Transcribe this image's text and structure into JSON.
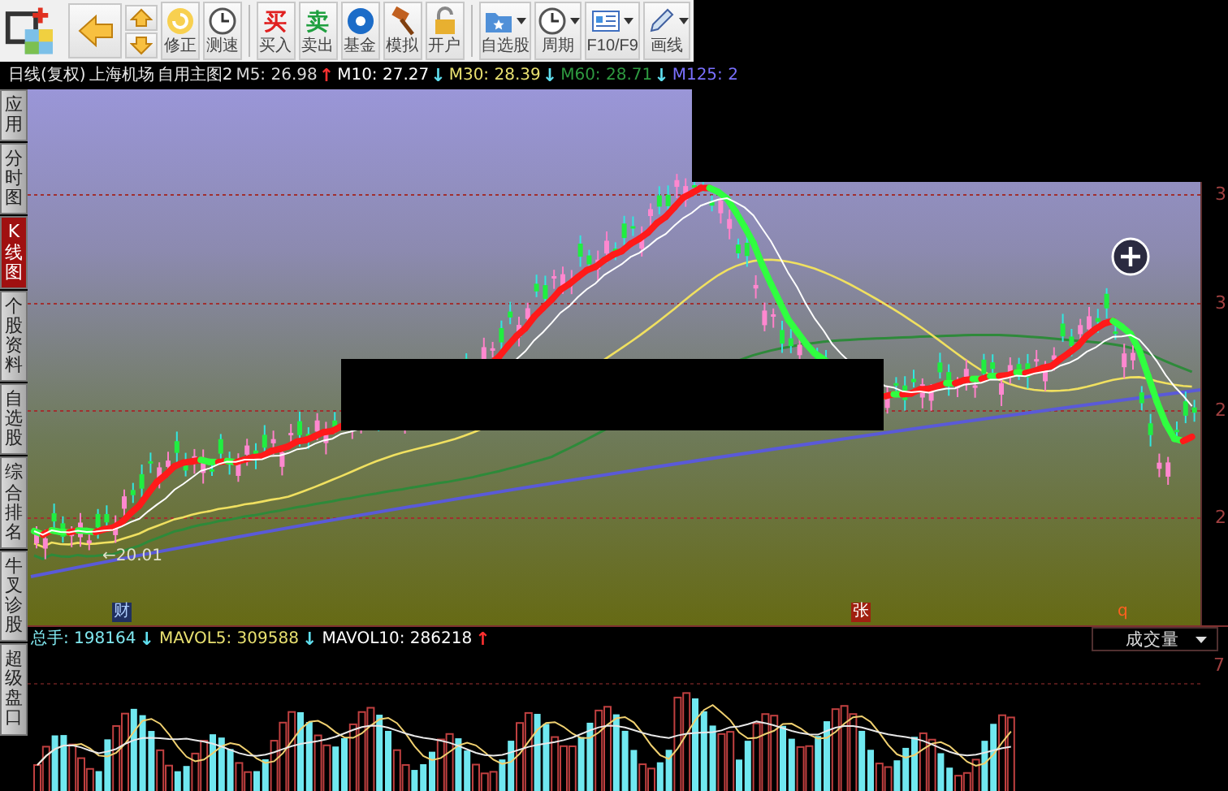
{
  "toolbar": {
    "buttons": [
      {
        "label": "修正",
        "dropdown": false
      },
      {
        "label": "测速",
        "dropdown": false
      },
      {
        "label": "买入",
        "icon_text": "买",
        "dropdown": false
      },
      {
        "label": "卖出",
        "icon_text": "卖",
        "dropdown": false
      },
      {
        "label": "基金",
        "dropdown": false
      },
      {
        "label": "模拟",
        "dropdown": false
      },
      {
        "label": "开户",
        "dropdown": false
      },
      {
        "label": "自选股",
        "dropdown": true
      },
      {
        "label": "周期",
        "dropdown": true
      },
      {
        "label": "F10/F9",
        "dropdown": true
      },
      {
        "label": "画线",
        "dropdown": true
      }
    ]
  },
  "info_bar": {
    "period": "日线(复权)",
    "stock": "上海机场",
    "template": "自用主图2",
    "indicators": [
      {
        "label": "M5: 26.98",
        "arrow": {
          "text": "↑",
          "color": "#ff3030"
        },
        "color": "#d8d8d8"
      },
      {
        "label": "M10: 27.27",
        "arrow": {
          "text": "↓",
          "color": "#60e0f0"
        },
        "color": "#ffffff"
      },
      {
        "label": "M30: 28.39",
        "arrow": {
          "text": "↓",
          "color": "#60e0f0"
        },
        "color": "#e8e070"
      },
      {
        "label": "M60: 28.71",
        "arrow": {
          "text": "↓",
          "color": "#60e0f0"
        },
        "color": "#2e9a40"
      },
      {
        "label": "M125: 2",
        "color": "#7a70ff"
      }
    ]
  },
  "sidebar": {
    "tabs": [
      {
        "label": "应用",
        "selected": false
      },
      {
        "label": "分时图",
        "selected": false
      },
      {
        "label": "K线图",
        "selected": true
      },
      {
        "label": "个股资料",
        "selected": false
      },
      {
        "label": "自选股",
        "selected": false
      },
      {
        "label": "综合排名",
        "selected": false
      },
      {
        "label": "牛叉诊股",
        "selected": false
      },
      {
        "label": "超级盘口",
        "selected": false
      }
    ]
  },
  "chart": {
    "price_axis": [
      "3",
      "3",
      "2",
      "2"
    ],
    "low_label": "←20.01",
    "markers": [
      {
        "label": "财",
        "kind": "finance"
      },
      {
        "label": "张",
        "kind": "event"
      },
      {
        "label": "q",
        "kind": "note"
      }
    ]
  },
  "volume": {
    "indicators": [
      {
        "label": "总手: 198164",
        "arrow": {
          "text": "↓",
          "color": "#60e0f0"
        },
        "color": "#80e8f0"
      },
      {
        "label": "MAVOL5: 309588",
        "arrow": {
          "text": "↓",
          "color": "#60e0f0"
        },
        "color": "#e8e070"
      },
      {
        "label": "MAVOL10: 286218",
        "arrow": {
          "text": "↑",
          "color": "#ff3030"
        },
        "color": "#ffffff"
      }
    ],
    "selector": "成交量",
    "axis": "7"
  }
}
